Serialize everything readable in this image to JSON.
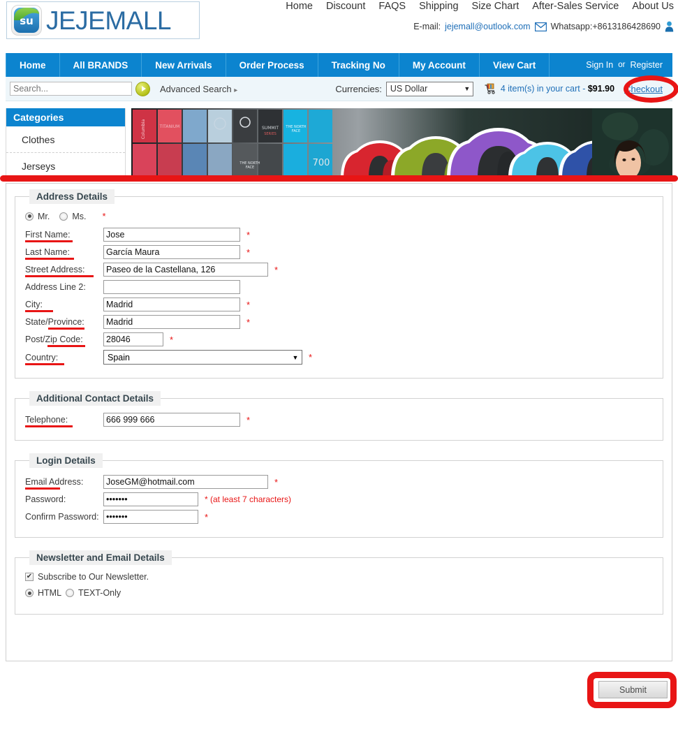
{
  "brand": {
    "name": "JEJEMALL",
    "logo_icon": "su-logo-icon"
  },
  "top_links": [
    "Home",
    "Discount",
    "FAQS",
    "Shipping",
    "Size Chart",
    "After-Sales Service",
    "About Us"
  ],
  "contact": {
    "email_label": "E-mail:",
    "email": "jejemall@outlook.com",
    "mail_icon": "envelope-icon",
    "whatsapp": "Whatsapp:+8613186428690",
    "person_icon": "person-icon"
  },
  "nav": {
    "items": [
      "Home",
      "All BRANDS",
      "New Arrivals",
      "Order Process",
      "Tracking No",
      "My Account",
      "View Cart"
    ],
    "sign_in": "Sign In",
    "or": "or",
    "register": "Register"
  },
  "subbar": {
    "search_placeholder": "Search...",
    "search_value": "",
    "go_icon": "go-arrow-icon",
    "advanced_search": "Advanced Search",
    "advanced_arrow": "▸",
    "currencies_label": "Currencies:",
    "currency_selected": "US Dollar",
    "currency_options": [
      "US Dollar"
    ],
    "chevron": "▼",
    "cart_icon": "shopping-cart-icon",
    "cart_text": "4 item(s) in your cart - ",
    "cart_total": "$91.90",
    "checkout": "Checkout"
  },
  "categories": {
    "title": "Categories",
    "items": [
      "Clothes",
      "Jerseys"
    ]
  },
  "banner": {
    "alt": "outdoor jackets promotional banner"
  },
  "form": {
    "address": {
      "legend": "Address Details",
      "salutation": {
        "options": [
          "Mr.",
          "Ms."
        ],
        "selected": "Mr."
      },
      "fields": [
        {
          "label": "First Name:",
          "value": "Jose",
          "required": true,
          "underlined": true
        },
        {
          "label": "Last Name:",
          "value": "García Maura",
          "required": true,
          "underlined": true
        },
        {
          "label": "Street Address:",
          "value": "Paseo de la Castellana, 126",
          "required": true,
          "underlined": true
        },
        {
          "label": "Address Line 2:",
          "value": "",
          "required": false,
          "underlined": false
        },
        {
          "label": "City:",
          "value": "Madrid",
          "required": true,
          "underlined": true
        },
        {
          "label": "State/Province:",
          "value": "Madrid",
          "required": true,
          "underlined": true
        },
        {
          "label": "Post/Zip Code:",
          "value": "28046",
          "required": true,
          "underlined": true
        }
      ],
      "country": {
        "label": "Country:",
        "selected": "Spain",
        "options": [
          "Spain"
        ],
        "required": true
      }
    },
    "contact_details": {
      "legend": "Additional Contact Details",
      "telephone": {
        "label": "Telephone:",
        "value": "666 999 666",
        "required": true
      }
    },
    "login": {
      "legend": "Login Details",
      "email": {
        "label": "Email Address:",
        "value": "JoseGM@hotmail.com",
        "required": true
      },
      "password": {
        "label": "Password:",
        "value": "•••••••",
        "hint": "* (at least 7 characters)"
      },
      "confirm": {
        "label": "Confirm Password:",
        "value": "•••••••",
        "required": true
      }
    },
    "newsletter": {
      "legend": "Newsletter and Email Details",
      "subscribe_label": "Subscribe to Our Newsletter.",
      "subscribe_checked": true,
      "check_glyph": "✔",
      "format_options": [
        "HTML",
        "TEXT-Only"
      ],
      "format_selected": "HTML"
    },
    "submit_label": "Submit",
    "required_mark": "*"
  },
  "annotations": {
    "color": "#e81515",
    "marks": [
      "checkout-ellipse",
      "divider-line",
      "submit-rect"
    ]
  },
  "colors": {
    "nav_blue": "#0c84cf",
    "link_blue": "#1f6fb8",
    "logo_blue": "#2b6ca3",
    "annotation_red": "#e81515",
    "subbar_bg": "#eef6fa"
  }
}
